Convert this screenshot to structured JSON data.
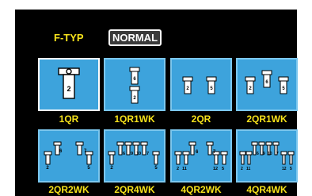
{
  "header": {
    "label": "F-TYP",
    "mode_button": "NORMAL"
  },
  "tiles": [
    {
      "caption": "1QR",
      "digits": [
        "2"
      ],
      "selected": true
    },
    {
      "caption": "1QR1WK",
      "digits": [
        "6",
        "2"
      ],
      "selected": false
    },
    {
      "caption": "2QR",
      "digits": [
        "2",
        "5"
      ],
      "selected": false
    },
    {
      "caption": "2QR1WK",
      "digits": [
        "2",
        "6",
        "5"
      ],
      "selected": false
    },
    {
      "caption": "2QR2WK",
      "digits": [
        "6",
        "7",
        "2",
        "5"
      ],
      "selected": false
    },
    {
      "caption": "2QR4WK",
      "digits": [
        "6",
        "9",
        "10",
        "7",
        "2",
        "5"
      ],
      "selected": false
    },
    {
      "caption": "4QR2WK",
      "digits": [
        "6",
        "7",
        "2",
        "11",
        "12",
        "5"
      ],
      "selected": false
    },
    {
      "caption": "4QR4WK",
      "digits": [
        "6",
        "9",
        "10",
        "7",
        "2",
        "11",
        "12",
        "5"
      ],
      "selected": false
    }
  ],
  "colors": {
    "background": "#000000",
    "accent_yellow": "#f6e21b",
    "tile_blue": "#3da3dc"
  },
  "icons": [
    "servo-icon"
  ]
}
